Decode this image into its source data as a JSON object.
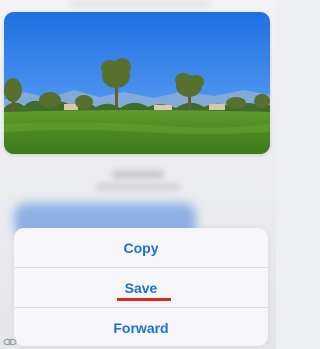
{
  "action_sheet": {
    "items": [
      {
        "label": "Copy"
      },
      {
        "label": "Save"
      },
      {
        "label": "Forward"
      }
    ],
    "highlighted_item": "Save"
  },
  "colors": {
    "action_text": "#1d6fd1",
    "highlight_underline": "#e0281f",
    "sheet_background": "#f6f6f8"
  },
  "photo": {
    "subject": "golf course with palm trees under blue sky"
  },
  "icons": {
    "corner": "link-icon"
  }
}
